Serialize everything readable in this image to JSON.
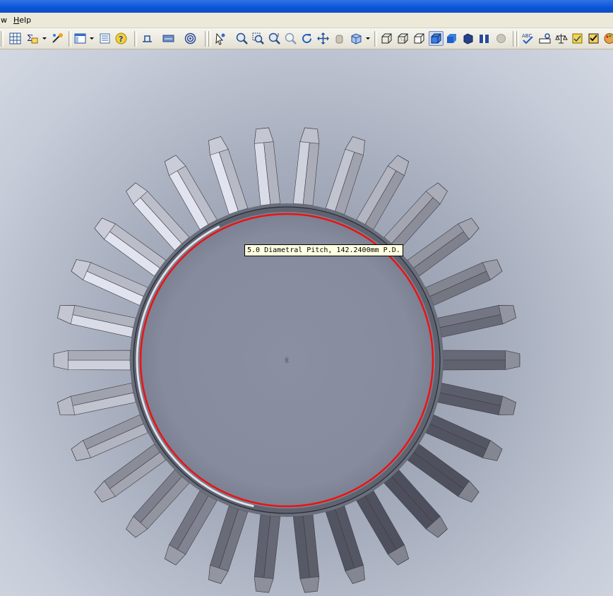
{
  "menubar": {
    "items": [
      {
        "accel": "",
        "rest": "w"
      },
      {
        "accel": "H",
        "rest": "elp"
      }
    ]
  },
  "toolbar": {
    "icons": [
      "grid-icon",
      "sum-icon",
      "dropdown-arrow",
      "magic-icon",
      "panel-icon",
      "dropdown-arrow",
      "list-icon",
      "help-icon",
      "measure-icon",
      "section-icon",
      "target-icon",
      "pointer-icon",
      "zoom-fit-icon",
      "zoom-area-icon",
      "zoom-in-out-icon",
      "zoom-selection-icon",
      "rotate-icon",
      "pan-icon",
      "hand-icon",
      "view-orientation-icon",
      "dropdown-arrow",
      "wireframe-icon",
      "hidden-lines-visible-icon",
      "hidden-lines-removed-icon",
      "shaded-with-edges-icon",
      "shaded-icon",
      "perspective-icon",
      "section-view-icon",
      "realview-icon",
      "spell-check-icon",
      "dimension-icon",
      "balance-icon",
      "smart-icon",
      "checkbox-icon",
      "palette-icon"
    ],
    "active_view": "shaded-with-edges-icon"
  },
  "viewport": {
    "tooltip": "5.0 Diametral Pitch, 142.2400mm P.D.",
    "gear": {
      "tooth_count": 30
    },
    "colors": {
      "pitch_circle": "#ee1111",
      "face": "#868c9d",
      "tooth_light": "#d9dbe6",
      "tooth_dark": "#4d505c"
    }
  }
}
